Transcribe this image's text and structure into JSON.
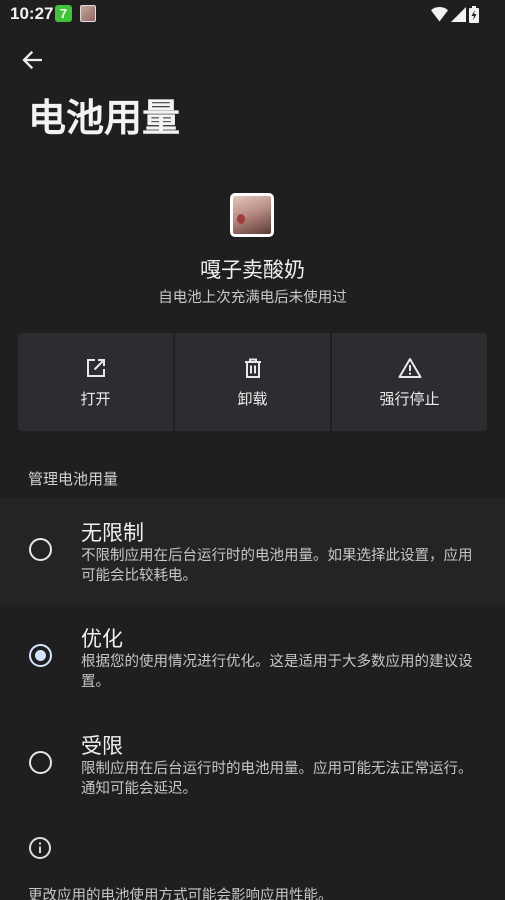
{
  "status_bar": {
    "time": "10:27",
    "badge": "7"
  },
  "page": {
    "title": "电池用量"
  },
  "app": {
    "name": "嘎子卖酸奶",
    "subtitle": "自电池上次充满电后未使用过"
  },
  "actions": [
    {
      "label": "打开",
      "icon": "open-external-icon"
    },
    {
      "label": "卸载",
      "icon": "trash-icon"
    },
    {
      "label": "强行停止",
      "icon": "warning-icon"
    }
  ],
  "section": {
    "header": "管理电池用量"
  },
  "options": [
    {
      "title": "无限制",
      "desc": "不限制应用在后台运行时的电池用量。如果选择此设置，应用可能会比较耗电。",
      "selected": false
    },
    {
      "title": "优化",
      "desc": "根据您的使用情况进行优化。这是适用于大多数应用的建议设置。",
      "selected": true
    },
    {
      "title": "受限",
      "desc": "限制应用在后台运行时的电池用量。应用可能无法正常运行。通知可能会延迟。",
      "selected": false
    }
  ],
  "footer": {
    "note": "更改应用的电池使用方式可能会影响应用性能。"
  },
  "colors": {
    "background": "#1f1f1f",
    "button_bg": "#2c2d30",
    "radio_selected": "#d6e3ff"
  }
}
